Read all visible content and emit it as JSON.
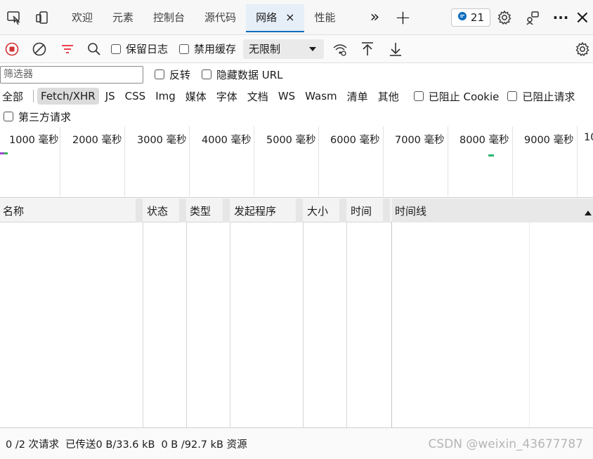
{
  "tabs": [
    {
      "label": "欢迎"
    },
    {
      "label": "元素"
    },
    {
      "label": "控制台"
    },
    {
      "label": "源代码"
    },
    {
      "label": "网络",
      "close": "×"
    },
    {
      "label": "性能"
    }
  ],
  "tabstrip": {
    "more": "»",
    "add": "+",
    "issues_count": "21",
    "menu": "···",
    "close": "×"
  },
  "toolbar": {
    "preserve_log": "保留日志",
    "disable_cache": "禁用缓存",
    "throttle": "无限制"
  },
  "filter": {
    "placeholder": "筛选器",
    "invert": "反转",
    "hide_data_urls": "隐藏数据 URL"
  },
  "types": [
    "全部",
    "Fetch/XHR",
    "JS",
    "CSS",
    "Img",
    "媒体",
    "字体",
    "文档",
    "WS",
    "Wasm",
    "清单",
    "其他"
  ],
  "active_type": "Fetch/XHR",
  "blocked": {
    "cookies": "已阻止 Cookie",
    "requests": "已阻止请求",
    "third_party": "第三方请求"
  },
  "overview": {
    "labels": [
      "1000 毫秒",
      "2000 毫秒",
      "3000 毫秒",
      "4000 毫秒",
      "5000 毫秒",
      "6000 毫秒",
      "7000 毫秒",
      "8000 毫秒",
      "9000 毫秒",
      "10"
    ]
  },
  "table": {
    "columns": [
      "名称",
      "状态",
      "类型",
      "发起程序",
      "大小",
      "时间",
      "时间线"
    ]
  },
  "status": {
    "requests": "0 /2 次请求",
    "transferred": "已传送0 B/33.6 kB",
    "resources": "0 B /92.7 kB 资源"
  },
  "watermark": "CSDN @weixin_43677787",
  "colors": {
    "accent": "#0f6cbd",
    "record": "#d13438",
    "filter_icon": "#e81123"
  }
}
